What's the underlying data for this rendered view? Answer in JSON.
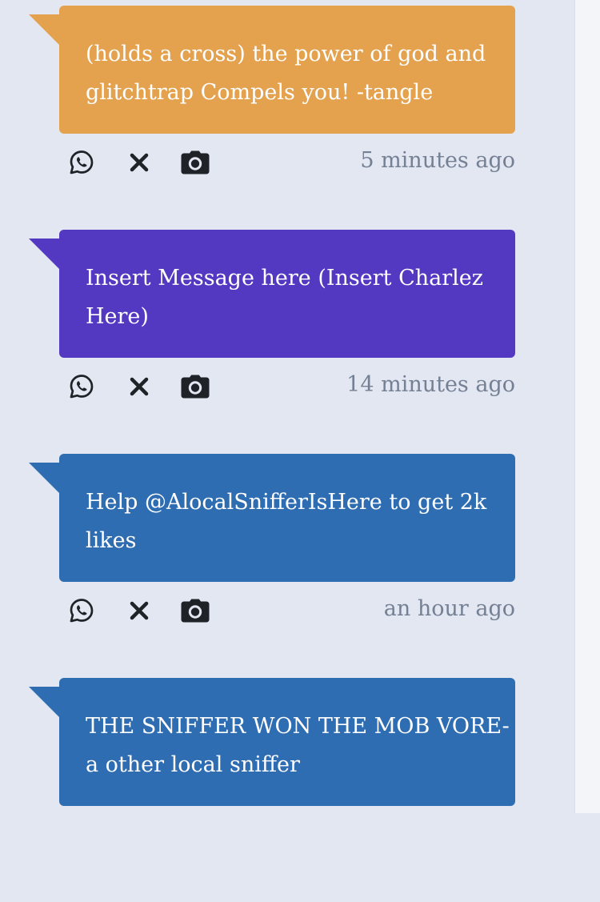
{
  "theme": {
    "background": "#e2e7f1",
    "icon_color": "#1f2328",
    "timestamp_color": "#758095"
  },
  "feed": {
    "messages": [
      {
        "text": "(holds a cross) the power of god and glitchtrap Compels you! -tangle",
        "time": "5 minutes ago",
        "color": "#e4a24f"
      },
      {
        "text": "Insert Message here (Insert Charlez Here)",
        "time": "14 minutes ago",
        "color": "#5339c1"
      },
      {
        "text": "Help @AlocalSnifferIsHere to get 2k likes",
        "time": "an hour ago",
        "color": "#2f6db2"
      },
      {
        "text": "THE SNIFFER WON THE MOB VORE-a other local sniffer",
        "time": "",
        "color": "#2f6db2"
      }
    ]
  },
  "icons": {
    "share": "whatsapp-icon",
    "close": "close-icon",
    "camera": "camera-icon"
  }
}
